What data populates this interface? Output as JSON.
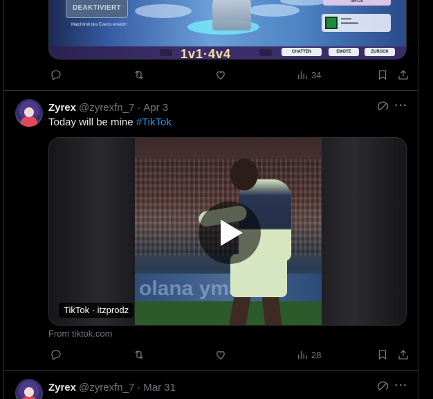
{
  "top_tweet": {
    "media": {
      "badge_text": "DEAKTIVIERT",
      "badge_sub": "Matchlimit des Events erreicht",
      "infos_label": "INFOS",
      "big_text": "1v1·4v4",
      "buttons": [
        "CHATTEN",
        "EMOTE",
        "ZURÜCK"
      ]
    },
    "views_count": "34"
  },
  "tweet": {
    "author_name": "Zyrex",
    "handle": "@zyrexfn_7",
    "separator": "·",
    "date": "Apr 3",
    "text": "Today will be mine ",
    "hashtag": "#TikTok",
    "video": {
      "source_label": "TikTok · itzprodz",
      "banner_text": "olana yma"
    },
    "from_label": "From tiktok.com",
    "views_count": "28"
  },
  "next_tweet": {
    "author_name": "Zyrex",
    "handle": "@zyrexfn_7",
    "separator": "·",
    "date": "Mar 31"
  },
  "icons": [
    "reply-icon",
    "retweet-icon",
    "like-icon",
    "views-icon",
    "bookmark-icon",
    "share-icon",
    "grok-icon",
    "more-icon",
    "play-icon"
  ],
  "colors": {
    "background": "#000000",
    "text": "#e7e9ea",
    "muted": "#71767b",
    "link": "#1d9bf0",
    "border": "#2f3336"
  }
}
